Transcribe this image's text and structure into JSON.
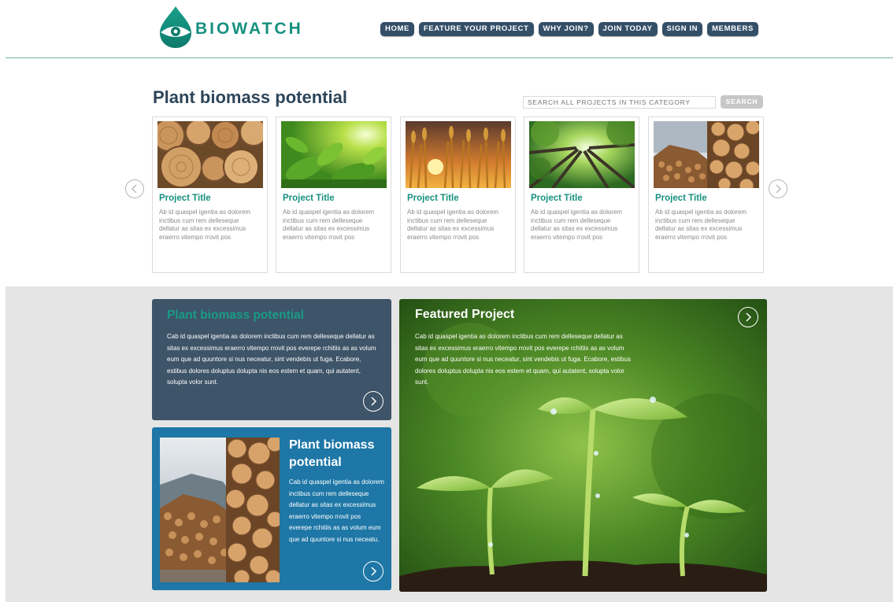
{
  "header": {
    "logo_text": "BIOWATCH",
    "nav": [
      "HOME",
      "FEATURE YOUR PROJECT",
      "WHY JOIN?",
      "JOIN TODAY",
      "SIGN IN",
      "MEMBERS"
    ]
  },
  "category": {
    "title": "Plant biomass potential",
    "search_placeholder": "SEARCH ALL PROJECTS IN THIS CATEGORY",
    "search_button": "SEARCH"
  },
  "cards": [
    {
      "title": "Project Title",
      "text": "Ab id quaspel igentia as dolorem inctibus cum rem delleseque dellatur as sitas ex excessimus eraerro vitempo rrovit pos",
      "image": "log-ends"
    },
    {
      "title": "Project Title",
      "text": "Ab id quaspel igentia as dolorem inctibus cum rem delleseque dellatur as sitas ex excessimus eraerro vitempo rrovit pos",
      "image": "green-leaves"
    },
    {
      "title": "Project Title",
      "text": "Ab id quaspel igentia as dolorem inctibus cum rem delleseque dellatur as sitas ex excessimus eraerro vitempo rrovit pos",
      "image": "wheat-sunset"
    },
    {
      "title": "Project Title",
      "text": "Ab id quaspel igentia as dolorem inctibus cum rem delleseque dellatur as sitas ex excessimus eraerro vitempo rrovit pos",
      "image": "forest-canopy"
    },
    {
      "title": "Project Title",
      "text": "Ab id quaspel igentia as dolorem inctibus cum rem delleseque dellatur as sitas ex excessimus eraerro vitempo rrovit pos",
      "image": "timber-stack"
    }
  ],
  "panel_dark": {
    "title": "Plant biomass potential",
    "text": "Cab id quaspel igentia as dolorem inctibus cum rem delleseque dellatur as sitas ex excessimus eraerro vitempo rrovit pos everepe rchitiis as as volum eum que ad quuntore si nus neceatur, sint vendebis ut fuga. Ecabore, estibus dolores doluptus dolupta nis eos estem et quam, qui autatent, solupta volor sunt."
  },
  "panel_blue": {
    "title": "Plant biomass potential",
    "text": "Cab id quaspel igentia as dolorem inctibus cum rem delleseque dellatur as sitas ex excessimus eraerro vitempo rrovit pos everepe rchitiis as as volum eum que ad quuntore si nus neceatu."
  },
  "featured": {
    "title": "Featured Project",
    "text": "Cab id quaspel igentia as dolorem inctibus cum rem delleseque dellatur as sitas ex excessimus eraerro vitempo rrovit pos everepe rchitiis as as volum eum que ad quuntore si nus neceatur, sint vendebis ut fuga. Ecabore, estibus dolores doluptus dolupta nis eos estem et quam, qui autatent, solupta volor sunt."
  },
  "colors": {
    "brand_teal": "#17907f",
    "nav_bg": "#344f68",
    "panel_dark": "#3e5468",
    "panel_blue": "#1e77a6",
    "grey_bg": "#e5e5e5"
  }
}
